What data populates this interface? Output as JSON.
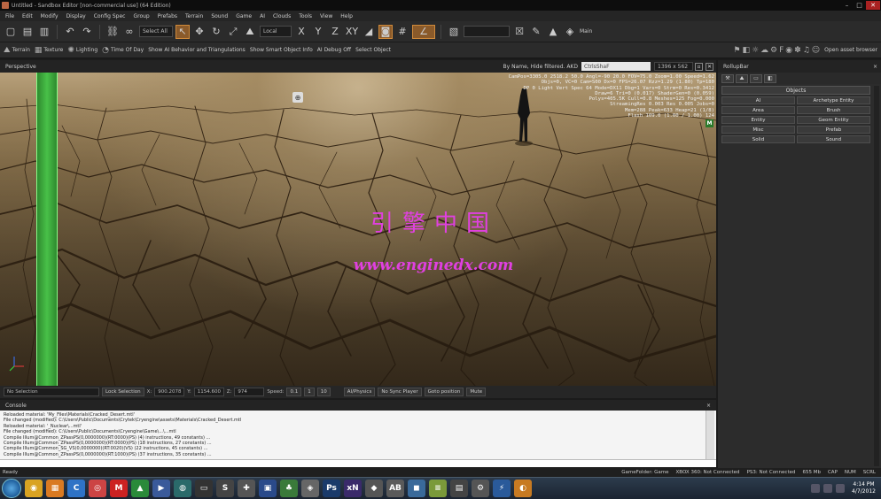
{
  "window": {
    "title": "Untitled - Sandbox Editor [non-commercial use] (64 Edition)"
  },
  "menu": [
    "File",
    "Edit",
    "Modify",
    "Display",
    "Config Spec",
    "Group",
    "Prefabs",
    "Terrain",
    "Sound",
    "Game",
    "AI",
    "Clouds",
    "Tools",
    "View",
    "Help"
  ],
  "toolbar1": {
    "select_all": "Select All",
    "coord_system": "Local",
    "axis_x": "X",
    "axis_y": "Y",
    "axis_z": "Z",
    "axis_xy": "XY",
    "main_label": "Main"
  },
  "toolbar2": {
    "terrain": "Terrain",
    "texture": "Texture",
    "lighting": "Lighting",
    "time_of_day": "Time Of Day",
    "show_ai": "Show AI Behavior and Triangulations",
    "show_smart": "Show Smart Object Info",
    "ai_debug": "AI Debug Off",
    "select_object": "Select Object",
    "open_asset_browser": "Open asset browser"
  },
  "viewport": {
    "title": "Perspective",
    "filter": "By Name, Hide filtered. AKD",
    "search_value": "CtrlsShaF",
    "resolution": "1396 x 562",
    "watermark_cn": "引擎中国",
    "watermark_url": "www.enginedx.com",
    "badge": "M"
  },
  "hud_lines": [
    "CamPos=3305.0 2518.2 50.0 Angl=-90 20.0 FOV=75.0 Zoom=1.00 Speed=1.62",
    "Objs=0, VC=0 Cam=S00 Dx=0 FPS=26.07 Rzz=1.29 (1.80) Tp=180",
    "DP 0 Light Vert Spec 64 Mode=DX11 Dbg=1 Vars=0 Strm=0 Res=0.3412",
    "Draw=6  Tri=0 (0.017)  ShaderGen=0 (0.059)",
    "Polys=405.5K Cull=0.8 Meshes=125  Fog=0.000",
    "StreamingRes 0.003 Res 0.005  Jobs=0",
    "Mem=288 Peak=633 Heap=21 (1/8)",
    "Flash 109.0 (1.00 / 1.00) 124"
  ],
  "rollup": {
    "title": "RollupBar",
    "objects_title": "Objects",
    "buttons": [
      "AI",
      "Archetype Entity",
      "Area",
      "Brush",
      "Entity",
      "Geom Entity",
      "Misc",
      "Prefab",
      "Solid",
      "Sound"
    ]
  },
  "status_row": {
    "selection": "No Selection",
    "lock_selection": "Lock Selection",
    "x_label": "X:",
    "x_value": "900.2078",
    "y_label": "Y:",
    "y_value": "1154.600",
    "z_label": "Z:",
    "z_value": "974",
    "speed_label": "Speed:",
    "speed_value": "0.1",
    "speed_1": "1",
    "speed_10": "10",
    "ai_physics": "AI/Physics",
    "no_sync": "No Sync Player",
    "goto_position": "Goto position",
    "mute": "Mute"
  },
  "console": {
    "title": "Console",
    "lines": [
      "Reloaded material: 'My_Files\\Materials\\Cracked_Desert.mtl'",
      "File changed (modified): C:\\Users\\Public\\Documents\\Crytek\\Cryengine\\assets\\Materials\\Cracked_Desert.mtl",
      "Reloaded material: '_Nuclear\\...mtl'",
      "File changed (modified): C:\\Users\\Public\\Documents\\Cryengine\\Game\\...\\...mtl",
      "Compile Illum@Common_ZPassPS(0,0000000)(RT:0000)(PS) (4) instructions, 49 constants) ...",
      "Compile Illum@Common_ZPassPS(0,0000000)(RT:0000)(PS) (18 instructions, 27 constants) ...",
      "Compile Illum@Common_SG_VS(0,0000000)(RT:0020)(VS) (22 instructions, 45 constants) ...",
      "Compile Illum@Common_ZPassPS(0,0000000)(RT:1000)(PS) (37 instructions, 35 constants) ..."
    ]
  },
  "statusbar": {
    "ready": "Ready",
    "game_folder": "GameFolder: Game",
    "xbox": "XBOX 360: Not Connected",
    "ps3": "PS3: Not Connected",
    "mem": "655 Mb",
    "cap": "CAP",
    "num": "NUM",
    "scrl": "SCRL"
  },
  "taskbar": {
    "time": "4:14 PM",
    "date": "4/7/2012",
    "icons": [
      {
        "name": "chrome-icon",
        "color": "#d9a322",
        "glyph": "◉"
      },
      {
        "name": "folder-icon",
        "color": "#d97a22",
        "glyph": "▦"
      },
      {
        "name": "app-c-icon",
        "color": "#2f73c6",
        "glyph": "C"
      },
      {
        "name": "browser-icon",
        "color": "#c44",
        "glyph": "◎"
      },
      {
        "name": "gmail-icon",
        "color": "#c22",
        "glyph": "M"
      },
      {
        "name": "app-green-icon",
        "color": "#2a8a3a",
        "glyph": "▲"
      },
      {
        "name": "media-icon",
        "color": "#3a5a9a",
        "glyph": "▶"
      },
      {
        "name": "globe-icon",
        "color": "#2a6a6a",
        "glyph": "◍"
      },
      {
        "name": "terminal-icon",
        "color": "#333",
        "glyph": "▭"
      },
      {
        "name": "app-s-icon",
        "color": "#444",
        "glyph": "S"
      },
      {
        "name": "tools-icon",
        "color": "#555",
        "glyph": "✚"
      },
      {
        "name": "monitor-icon",
        "color": "#2a4a8a",
        "glyph": "▣"
      },
      {
        "name": "tree-icon",
        "color": "#3a7a3a",
        "glyph": "♣"
      },
      {
        "name": "photo-icon",
        "color": "#666",
        "glyph": "◈"
      },
      {
        "name": "photoshop-icon",
        "color": "#1a3a6a",
        "glyph": "Ps"
      },
      {
        "name": "xn-icon",
        "color": "#3a2a6a",
        "glyph": "xN"
      },
      {
        "name": "game-icon",
        "color": "#555",
        "glyph": "◆"
      },
      {
        "name": "ab-icon",
        "color": "#5a5a5a",
        "glyph": "AB"
      },
      {
        "name": "app-blue-icon",
        "color": "#3a6a9a",
        "glyph": "◼"
      },
      {
        "name": "notepad-icon",
        "color": "#7a9a3a",
        "glyph": "≡"
      },
      {
        "name": "film-icon",
        "color": "#444",
        "glyph": "▤"
      },
      {
        "name": "settings-icon",
        "color": "#555",
        "glyph": "⚙"
      },
      {
        "name": "flash-icon",
        "color": "#2a5a9a",
        "glyph": "⚡"
      },
      {
        "name": "crysis-icon",
        "color": "#c77a22",
        "glyph": "◐"
      }
    ]
  }
}
